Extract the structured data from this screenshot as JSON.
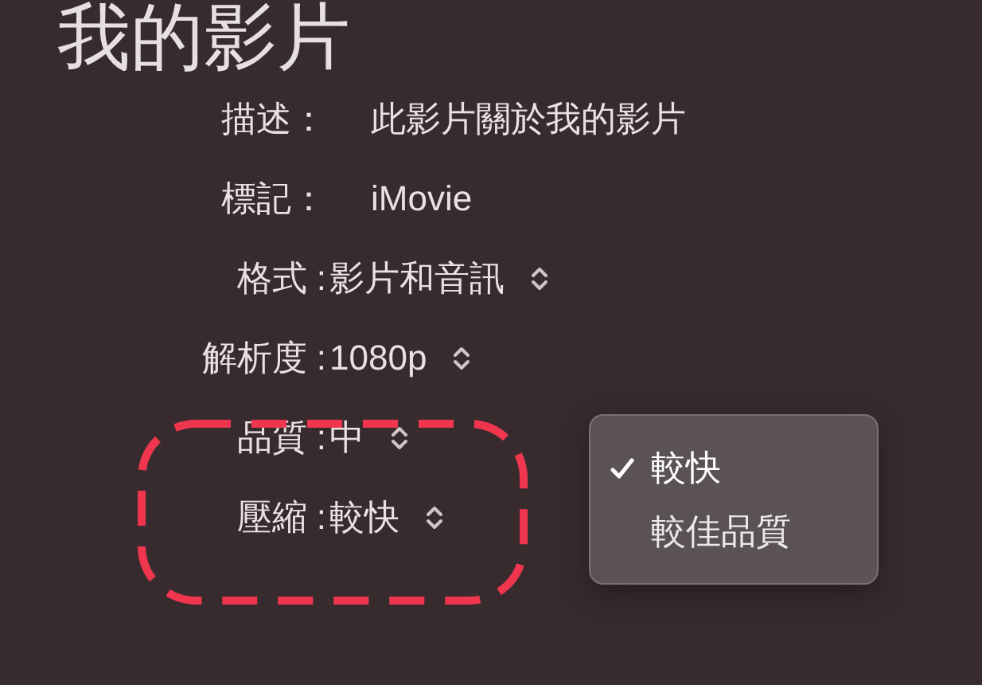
{
  "title": "我的影片",
  "fields": [
    {
      "kind": "text",
      "label": "描述：",
      "value": "此影片關於我的影片"
    },
    {
      "kind": "text",
      "label": "標記：",
      "value": "iMovie"
    },
    {
      "kind": "popup",
      "label": "格式 :",
      "value": "影片和音訊"
    },
    {
      "kind": "popup",
      "label": "解析度 :",
      "value": "1080p"
    },
    {
      "kind": "popup",
      "label": "品質 :",
      "value": "中"
    },
    {
      "kind": "popup",
      "label": "壓縮 :",
      "value": "較快"
    }
  ],
  "menu": {
    "items": [
      {
        "label": "較快",
        "selected": true
      },
      {
        "label": "較佳品質",
        "selected": false
      }
    ]
  }
}
